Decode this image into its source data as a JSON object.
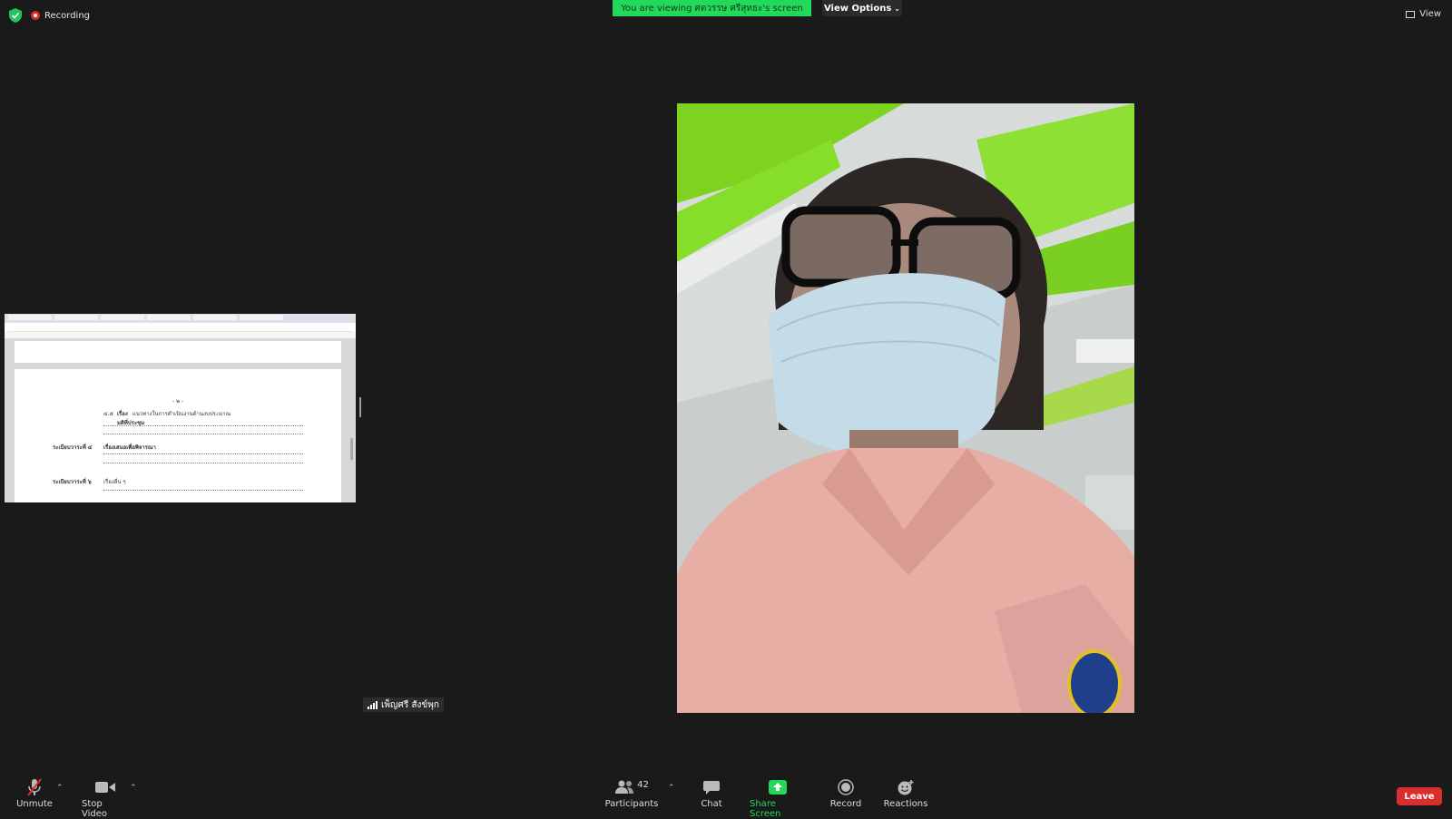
{
  "top_bar": {
    "recording_label": "Recording",
    "banner_prefix": "You are viewing ",
    "banner_name": "ศตวรรษ ศรีสุทธะ",
    "banner_suffix": "'s screen",
    "view_options_label": "View Options",
    "view_label": "View"
  },
  "share_thumbnail": {
    "doc_page_marker": "- ๒ -",
    "line1_num": "๔.๕",
    "line1_prefix": "เรื่อง",
    "line1_text": "แนวทางในการดำเนินงานด้านงบประมาณ",
    "line1_sub": "มติที่ประชุม",
    "agenda4_label": "ระเบียบวาระที่ ๔",
    "agenda4_text": "เรื่องเสนอเพื่อพิจารณา",
    "agenda5_label": "ระเบียบวาระที่ ๖",
    "agenda5_text": "เรื่องอื่น ๆ"
  },
  "participant": {
    "name": "เพ็ญศรี สังข์พุก"
  },
  "toolbar": {
    "unmute_label": "Unmute",
    "stop_video_label": "Stop Video",
    "participants_label": "Participants",
    "participants_count": "42",
    "chat_label": "Chat",
    "share_screen_label": "Share Screen",
    "record_label": "Record",
    "reactions_label": "Reactions",
    "leave_label": "Leave"
  },
  "colors": {
    "share_green": "#23d959",
    "leave_red": "#d82e2e",
    "background": "#1a1a1a"
  }
}
